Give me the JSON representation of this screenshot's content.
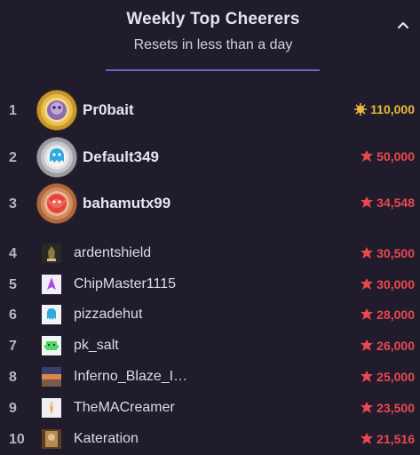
{
  "header": {
    "title": "Weekly Top Cheerers",
    "subtitle": "Resets in less than a day"
  },
  "colors": {
    "background": "#201c2b",
    "divider": "#6f5fc7",
    "gold": "#e7b93e",
    "red": "#e8494f"
  },
  "leaders": [
    {
      "rank": "1",
      "name": "Pr0bait",
      "amount": "110,000",
      "tier": "gold",
      "currency_icon": "gold-bits-icon"
    },
    {
      "rank": "2",
      "name": "Default349",
      "amount": "50,000",
      "tier": "silver",
      "currency_icon": "red-bits-icon"
    },
    {
      "rank": "3",
      "name": "bahamutx99",
      "amount": "34,548",
      "tier": "bronze",
      "currency_icon": "red-bits-icon"
    },
    {
      "rank": "4",
      "name": "ardentshield",
      "amount": "30,500",
      "currency_icon": "red-bits-icon"
    },
    {
      "rank": "5",
      "name": "ChipMaster1115",
      "amount": "30,000",
      "currency_icon": "red-bits-icon"
    },
    {
      "rank": "6",
      "name": "pizzadehut",
      "amount": "28,000",
      "currency_icon": "red-bits-icon"
    },
    {
      "rank": "7",
      "name": "pk_salt",
      "amount": "26,000",
      "currency_icon": "red-bits-icon"
    },
    {
      "rank": "8",
      "name": "Inferno_Blaze_I…",
      "amount": "25,000",
      "currency_icon": "red-bits-icon"
    },
    {
      "rank": "9",
      "name": "TheMACreamer",
      "amount": "23,500",
      "currency_icon": "red-bits-icon"
    },
    {
      "rank": "10",
      "name": "Kateration",
      "amount": "21,516",
      "currency_icon": "red-bits-icon"
    }
  ]
}
